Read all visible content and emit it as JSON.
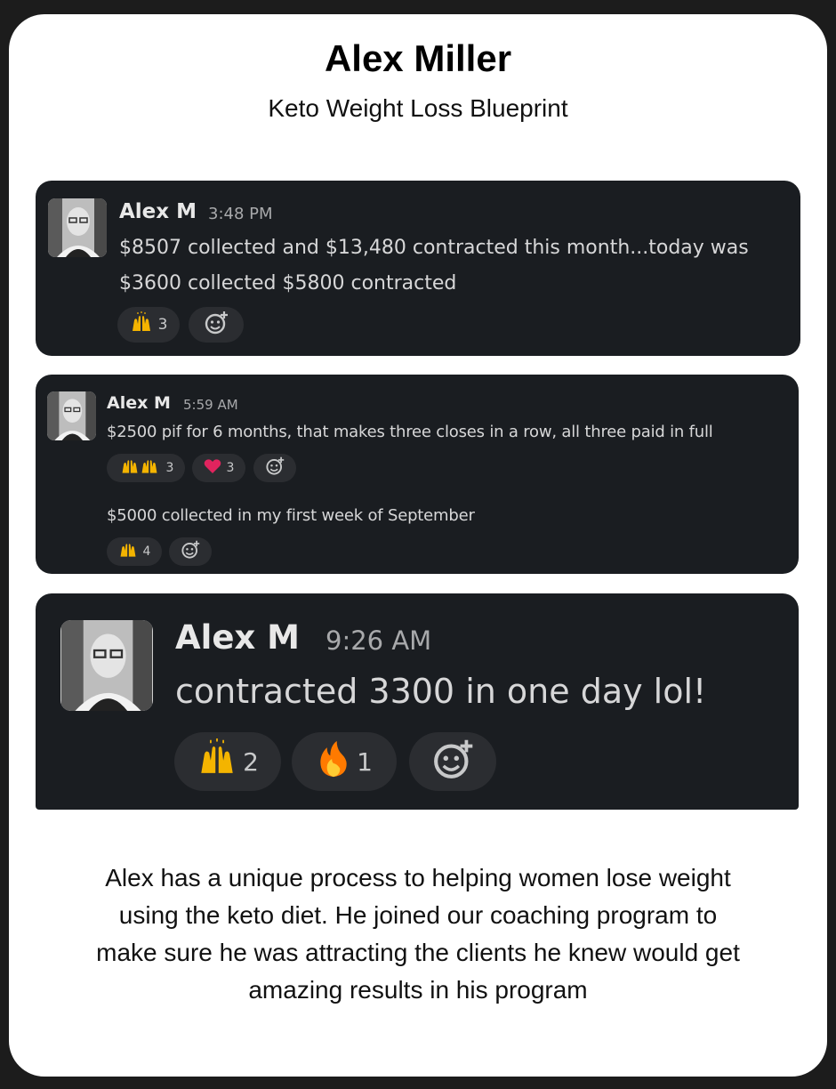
{
  "header": {
    "title": "Alex Miller",
    "subtitle": "Keto Weight Loss Blueprint"
  },
  "messages": [
    {
      "author": "Alex M",
      "time": "3:48 PM",
      "text": "$8507 collected and $13,480 contracted this month...today was $3600 collected $5800 contracted",
      "reactions": [
        {
          "icon": "raised-hands-icon",
          "count": "3"
        }
      ]
    },
    {
      "author": "Alex M",
      "time": "5:59 AM",
      "text": "$2500 pif for 6 months, that makes three closes in a row, all three paid in full",
      "reactions": [
        {
          "icon": "raised-hands-icon",
          "count": "3"
        },
        {
          "icon": "heart-icon",
          "count": "3"
        }
      ],
      "followup_text": "$5000 collected in my first week of September",
      "followup_reactions": [
        {
          "icon": "raised-hands-icon",
          "count": "4"
        }
      ]
    },
    {
      "author": "Alex M",
      "time": "9:26 AM",
      "text": "contracted 3300 in one day lol!",
      "reactions": [
        {
          "icon": "raised-hands-icon",
          "count": "2"
        },
        {
          "icon": "fire-icon",
          "count": "1"
        }
      ]
    }
  ],
  "footer": {
    "text": "Alex has a unique process to helping women lose weight using the keto diet. He joined our coaching program to make sure he was attracting the clients he knew would get amazing results in his program"
  },
  "colors": {
    "background": "#1c1c1c",
    "card": "#ffffff",
    "message_bg": "#1a1d21",
    "reaction_bg": "#2b2d31",
    "heart": "#e0245e",
    "hands": "#f4b400",
    "fire": "#ff7a00"
  }
}
